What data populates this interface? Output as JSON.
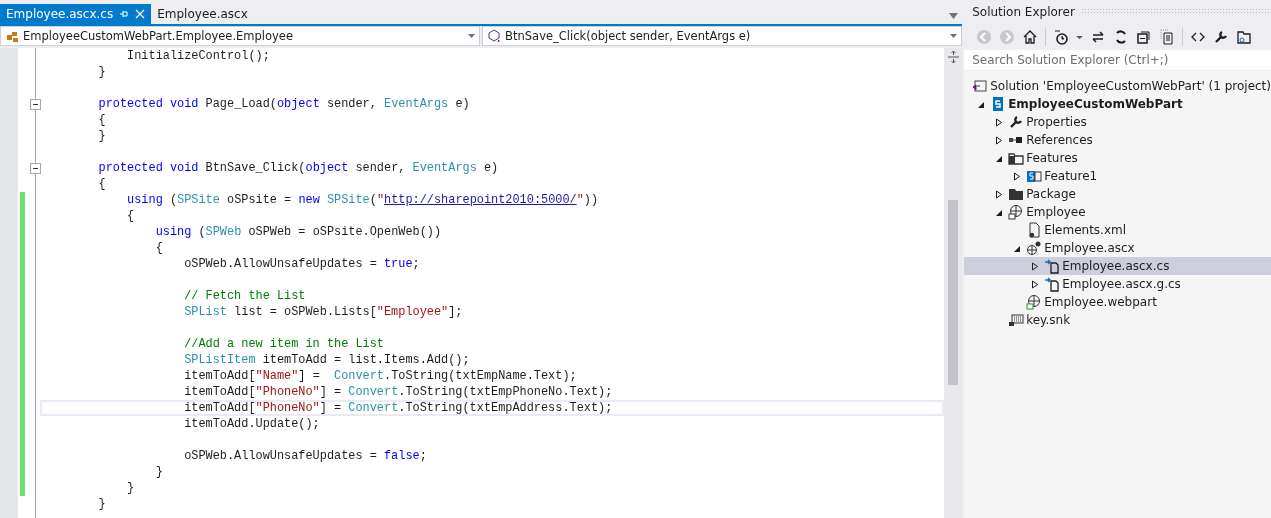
{
  "tabs": [
    {
      "label": "Employee.ascx.cs",
      "selected": true
    },
    {
      "label": "Employee.ascx",
      "selected": false
    }
  ],
  "navigation_bar": {
    "type_dropdown": "EmployeeCustomWebPart.Employee.Employee",
    "member_dropdown": "BtnSave_Click(object sender, EventArgs e)"
  },
  "editor": {
    "lines": [
      {
        "changed": false,
        "current": false,
        "fold": false,
        "tokens": [
          {
            "kind": "plain",
            "text": "        InitializeControl();"
          }
        ]
      },
      {
        "changed": false,
        "current": false,
        "fold": false,
        "tokens": [
          {
            "kind": "plain",
            "text": "    }"
          }
        ]
      },
      {
        "changed": false,
        "current": false,
        "fold": false
      },
      {
        "changed": false,
        "current": false,
        "fold": true,
        "tokens": [
          {
            "kind": "keyword",
            "text": "    protected void"
          },
          {
            "kind": "plain",
            "text": " Page_Load("
          },
          {
            "kind": "keyword",
            "text": "object"
          },
          {
            "kind": "plain",
            "text": " sender, "
          },
          {
            "kind": "type",
            "text": "EventArgs"
          },
          {
            "kind": "plain",
            "text": " e)"
          }
        ]
      },
      {
        "changed": false,
        "current": false,
        "fold": false,
        "tokens": [
          {
            "kind": "plain",
            "text": "    {"
          }
        ]
      },
      {
        "changed": false,
        "current": false,
        "fold": false,
        "tokens": [
          {
            "kind": "plain",
            "text": "    }"
          }
        ]
      },
      {
        "changed": false,
        "current": false,
        "fold": false
      },
      {
        "changed": false,
        "current": false,
        "fold": true,
        "tokens": [
          {
            "kind": "keyword",
            "text": "    protected void"
          },
          {
            "kind": "plain",
            "text": " BtnSave_Click("
          },
          {
            "kind": "keyword",
            "text": "object"
          },
          {
            "kind": "plain",
            "text": " sender, "
          },
          {
            "kind": "type",
            "text": "EventArgs"
          },
          {
            "kind": "plain",
            "text": " e)"
          }
        ]
      },
      {
        "changed": false,
        "current": false,
        "fold": false,
        "tokens": [
          {
            "kind": "plain",
            "text": "    {"
          }
        ]
      },
      {
        "changed": true,
        "current": false,
        "fold": false,
        "tokens": [
          {
            "kind": "keyword",
            "text": "        using"
          },
          {
            "kind": "plain",
            "text": " ("
          },
          {
            "kind": "type",
            "text": "SPSite"
          },
          {
            "kind": "plain",
            "text": " oSPsite = "
          },
          {
            "kind": "keyword",
            "text": "new "
          },
          {
            "kind": "type",
            "text": "SPSite"
          },
          {
            "kind": "plain",
            "text": "("
          },
          {
            "kind": "string",
            "text": "\""
          },
          {
            "kind": "link",
            "text": "http://sharepoint2010:5000/"
          },
          {
            "kind": "string",
            "text": "\""
          },
          {
            "kind": "plain",
            "text": "))"
          }
        ]
      },
      {
        "changed": true,
        "current": false,
        "fold": false,
        "tokens": [
          {
            "kind": "plain",
            "text": "        {"
          }
        ]
      },
      {
        "changed": true,
        "current": false,
        "fold": false,
        "tokens": [
          {
            "kind": "keyword",
            "text": "            using"
          },
          {
            "kind": "plain",
            "text": " ("
          },
          {
            "kind": "type",
            "text": "SPWeb"
          },
          {
            "kind": "plain",
            "text": " oSPWeb = oSPsite.OpenWeb())"
          }
        ]
      },
      {
        "changed": true,
        "current": false,
        "fold": false,
        "tokens": [
          {
            "kind": "plain",
            "text": "            {"
          }
        ]
      },
      {
        "changed": true,
        "current": false,
        "fold": false,
        "tokens": [
          {
            "kind": "plain",
            "text": "                oSPWeb.AllowUnsafeUpdates = "
          },
          {
            "kind": "keyword",
            "text": "true"
          },
          {
            "kind": "plain",
            "text": ";"
          }
        ]
      },
      {
        "changed": true,
        "current": false,
        "fold": false
      },
      {
        "changed": true,
        "current": false,
        "fold": false,
        "tokens": [
          {
            "kind": "comment",
            "text": "                // Fetch the List"
          }
        ]
      },
      {
        "changed": true,
        "current": false,
        "fold": false,
        "tokens": [
          {
            "kind": "type",
            "text": "                SPList"
          },
          {
            "kind": "plain",
            "text": " list = oSPWeb.Lists["
          },
          {
            "kind": "string",
            "text": "\"Employee\""
          },
          {
            "kind": "plain",
            "text": "];"
          }
        ]
      },
      {
        "changed": true,
        "current": false,
        "fold": false
      },
      {
        "changed": true,
        "current": false,
        "fold": false,
        "tokens": [
          {
            "kind": "comment",
            "text": "                //Add a new item in the List"
          }
        ]
      },
      {
        "changed": true,
        "current": false,
        "fold": false,
        "tokens": [
          {
            "kind": "type",
            "text": "                SPListItem"
          },
          {
            "kind": "plain",
            "text": " itemToAdd = list.Items.Add();"
          }
        ]
      },
      {
        "changed": true,
        "current": false,
        "fold": false,
        "tokens": [
          {
            "kind": "plain",
            "text": "                itemToAdd["
          },
          {
            "kind": "string",
            "text": "\"Name\""
          },
          {
            "kind": "plain",
            "text": "] =  "
          },
          {
            "kind": "type",
            "text": "Convert"
          },
          {
            "kind": "plain",
            "text": ".ToString(txtEmpName.Text);"
          }
        ]
      },
      {
        "changed": true,
        "current": false,
        "fold": false,
        "tokens": [
          {
            "kind": "plain",
            "text": "                itemToAdd["
          },
          {
            "kind": "string",
            "text": "\"PhoneNo\""
          },
          {
            "kind": "plain",
            "text": "] = "
          },
          {
            "kind": "type",
            "text": "Convert"
          },
          {
            "kind": "plain",
            "text": ".ToString(txtEmpPhoneNo.Text);"
          }
        ]
      },
      {
        "changed": true,
        "current": true,
        "fold": false,
        "tokens": [
          {
            "kind": "plain",
            "text": "                itemToAdd["
          },
          {
            "kind": "string",
            "text": "\"PhoneNo\""
          },
          {
            "kind": "plain",
            "text": "] = "
          },
          {
            "kind": "type",
            "text": "Convert"
          },
          {
            "kind": "plain",
            "text": ".ToString(txtEmpAddress.Text);"
          }
        ]
      },
      {
        "changed": true,
        "current": false,
        "fold": false,
        "tokens": [
          {
            "kind": "plain",
            "text": "                itemToAdd.Update();"
          }
        ]
      },
      {
        "changed": true,
        "current": false,
        "fold": false
      },
      {
        "changed": true,
        "current": false,
        "fold": false,
        "tokens": [
          {
            "kind": "plain",
            "text": "                oSPWeb.AllowUnsafeUpdates = "
          },
          {
            "kind": "keyword",
            "text": "false"
          },
          {
            "kind": "plain",
            "text": ";"
          }
        ]
      },
      {
        "changed": true,
        "current": false,
        "fold": false,
        "tokens": [
          {
            "kind": "plain",
            "text": "            }"
          }
        ]
      },
      {
        "changed": true,
        "current": false,
        "fold": false,
        "tokens": [
          {
            "kind": "plain",
            "text": "        }"
          }
        ]
      },
      {
        "changed": false,
        "current": false,
        "fold": false,
        "tokens": [
          {
            "kind": "plain",
            "text": "    }"
          }
        ]
      }
    ]
  },
  "solution_explorer": {
    "title": "Solution Explorer",
    "search": {
      "placeholder": "Search Solution Explorer (Ctrl+;)"
    },
    "tree": [
      {
        "kind": "solution",
        "label": "Solution 'EmployeeCustomWebPart' (1 project)",
        "selected": false,
        "children": [
          {
            "kind": "project",
            "label": "EmployeeCustomWebPart",
            "selected": false,
            "expanded": true,
            "children": [
              {
                "kind": "properties",
                "label": "Properties",
                "selected": false,
                "expanded": false
              },
              {
                "kind": "references",
                "label": "References",
                "selected": false,
                "expanded": false
              },
              {
                "kind": "folder",
                "label": "Features",
                "selected": false,
                "expanded": true,
                "children": [
                  {
                    "kind": "feature",
                    "label": "Feature1",
                    "selected": false,
                    "expanded": false
                  }
                ]
              },
              {
                "kind": "package",
                "label": "Package",
                "selected": false,
                "expanded": false
              },
              {
                "kind": "spitem",
                "label": "Employee",
                "selected": false,
                "expanded": true,
                "children": [
                  {
                    "kind": "xml",
                    "label": "Elements.xml",
                    "selected": false
                  },
                  {
                    "kind": "ascx",
                    "label": "Employee.ascx",
                    "selected": false,
                    "expanded": true,
                    "children": [
                      {
                        "kind": "cs",
                        "label": "Employee.ascx.cs",
                        "selected": true,
                        "expanded": false
                      },
                      {
                        "kind": "cs",
                        "label": "Employee.ascx.g.cs",
                        "selected": false,
                        "expanded": false
                      }
                    ]
                  },
                  {
                    "kind": "webpart",
                    "label": "Employee.webpart",
                    "selected": false
                  }
                ]
              },
              {
                "kind": "snk",
                "label": "key.snk",
                "selected": false
              }
            ]
          }
        ]
      }
    ]
  }
}
